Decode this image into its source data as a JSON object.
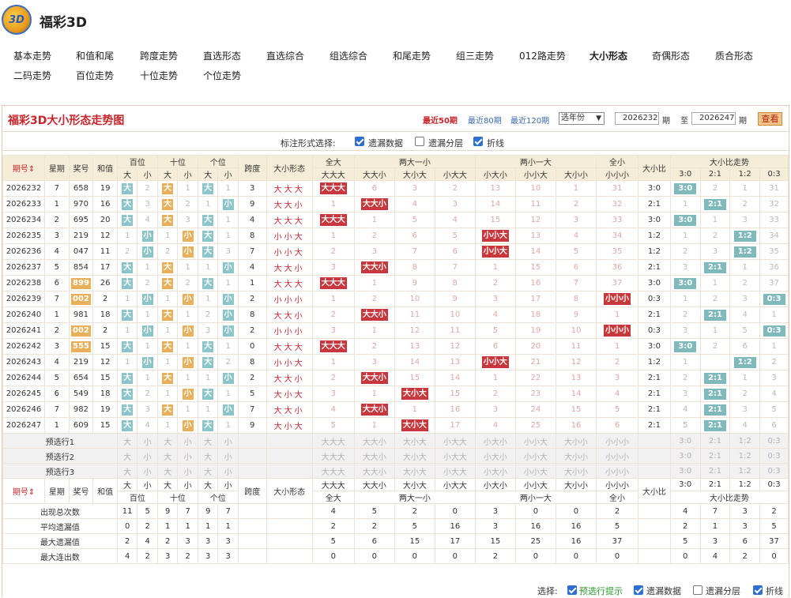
{
  "site": {
    "logo": "3D",
    "title": "福彩3D"
  },
  "nav": [
    "基本走势",
    "和值和尾",
    "跨度走势",
    "直选形态",
    "直选综合",
    "组选综合",
    "和尾走势",
    "组三走势",
    "012路走势",
    "大小形态",
    "奇偶形态",
    "质合形态",
    "二码走势",
    "百位走势",
    "十位走势",
    "个位走势"
  ],
  "nav_active": 9,
  "panel": {
    "title": "福彩3D大小形态走势图",
    "links": [
      "最近50期",
      "最近80期",
      "最近120期"
    ],
    "year_select": "选年份",
    "from": "2026232",
    "to": "2026247",
    "qi1": "期",
    "to_label": "至",
    "qi2": "期",
    "query": "查看"
  },
  "options": {
    "label": "标注形式选择:",
    "items": [
      {
        "label": "遗漏数据",
        "checked": true
      },
      {
        "label": "遗漏分层",
        "checked": false
      },
      {
        "label": "折线",
        "checked": true
      }
    ]
  },
  "headers": {
    "period": "期号",
    "week": "星期",
    "prize": "奖号",
    "sum": "和值",
    "bai": "百位",
    "shi": "十位",
    "ge": "个位",
    "big": "大",
    "small": "小",
    "span": "跨度",
    "shape": "大小形态",
    "g_all_big": "全大",
    "g_two_big": "两大一小",
    "g_two_small": "两小一大",
    "g_all_small": "全小",
    "ratio": "大小比",
    "trend": "大小比走势",
    "sub_all_big": "大大大",
    "sub_two_big": [
      "大大小",
      "大小大",
      "小大大"
    ],
    "sub_two_small": [
      "小大小",
      "小小大",
      "大小小"
    ],
    "sub_all_small": "小小小",
    "ratios": [
      "3:0",
      "2:1",
      "1:2",
      "0:3"
    ],
    "sort_icon": "⇕"
  },
  "rows": [
    {
      "p": "2026232",
      "w": "7",
      "n": "658",
      "nh": "",
      "s": "19",
      "d": [
        "大",
        "2",
        "大",
        "1",
        "大",
        "1"
      ],
      "sp": "3",
      "sh": "大大大",
      "a": [
        {
          "v": "大大大",
          "h": 1
        },
        "6",
        "3",
        "2",
        "13",
        "10",
        "1",
        "31"
      ],
      "r": "3:0",
      "t": [
        {
          "v": "3:0",
          "h": 1
        },
        "2",
        "1",
        "31"
      ]
    },
    {
      "p": "2026233",
      "w": "1",
      "n": "970",
      "nh": "",
      "s": "16",
      "d": [
        "大",
        "3",
        "大",
        "2",
        "1",
        "小"
      ],
      "sp": "9",
      "sh": "大大小",
      "a": [
        "1",
        {
          "v": "大大小",
          "h": 1
        },
        "4",
        "3",
        "14",
        "11",
        "2",
        "32"
      ],
      "r": "2:1",
      "t": [
        "1",
        {
          "v": "2:1",
          "h": 1
        },
        "2",
        "32"
      ]
    },
    {
      "p": "2026234",
      "w": "2",
      "n": "695",
      "nh": "",
      "s": "20",
      "d": [
        "大",
        "4",
        "大",
        "3",
        "大",
        "1"
      ],
      "sp": "4",
      "sh": "大大大",
      "a": [
        {
          "v": "大大大",
          "h": 1
        },
        "1",
        "5",
        "4",
        "15",
        "12",
        "3",
        "33"
      ],
      "r": "3:0",
      "t": [
        {
          "v": "3:0",
          "h": 1
        },
        "1",
        "3",
        "33"
      ]
    },
    {
      "p": "2026235",
      "w": "3",
      "n": "219",
      "nh": "",
      "s": "12",
      "d": [
        "1",
        "小",
        "1",
        "小",
        "大",
        "1"
      ],
      "sp": "8",
      "sh": "小小大",
      "a": [
        "1",
        "2",
        "6",
        "5",
        {
          "v": "小小大",
          "h": 1
        },
        "13",
        "4",
        "34"
      ],
      "r": "1:2",
      "t": [
        "1",
        "2",
        {
          "v": "1:2",
          "h": 1
        },
        "34"
      ]
    },
    {
      "p": "2026236",
      "w": "4",
      "n": "047",
      "nh": "",
      "s": "11",
      "d": [
        "2",
        "小",
        "2",
        "小",
        "大",
        "3"
      ],
      "sp": "7",
      "sh": "小小大",
      "a": [
        "2",
        "3",
        "7",
        "6",
        {
          "v": "小小大",
          "h": 1
        },
        "14",
        "5",
        "35"
      ],
      "r": "1:2",
      "t": [
        "2",
        "3",
        {
          "v": "1:2",
          "h": 1
        },
        "35"
      ]
    },
    {
      "p": "2026237",
      "w": "5",
      "n": "854",
      "nh": "",
      "s": "17",
      "d": [
        "大",
        "1",
        "大",
        "1",
        "1",
        "小"
      ],
      "sp": "4",
      "sh": "大大小",
      "a": [
        "3",
        {
          "v": "大大小",
          "h": 1
        },
        "8",
        "7",
        "1",
        "15",
        "6",
        "36"
      ],
      "r": "2:1",
      "t": [
        "3",
        {
          "v": "2:1",
          "h": 1
        },
        "1",
        "36"
      ]
    },
    {
      "p": "2026238",
      "w": "6",
      "n": "899",
      "nh": "o",
      "s": "26",
      "d": [
        "大",
        "2",
        "大",
        "2",
        "大",
        "1"
      ],
      "sp": "1",
      "sh": "大大大",
      "a": [
        {
          "v": "大大大",
          "h": 1
        },
        "1",
        "9",
        "8",
        "2",
        "16",
        "7",
        "37"
      ],
      "r": "3:0",
      "t": [
        {
          "v": "3:0",
          "h": 1
        },
        "1",
        "2",
        "37"
      ]
    },
    {
      "p": "2026239",
      "w": "7",
      "n": "002",
      "nh": "o",
      "s": "2",
      "d": [
        "1",
        "小",
        "1",
        "小",
        "1",
        "小"
      ],
      "sp": "2",
      "sh": "小小小",
      "a": [
        "1",
        "2",
        "10",
        "9",
        "3",
        "17",
        "8",
        {
          "v": "小小小",
          "h": 1
        }
      ],
      "r": "0:3",
      "t": [
        "1",
        "2",
        "3",
        {
          "v": "0:3",
          "h": 1
        }
      ]
    },
    {
      "p": "2026240",
      "w": "1",
      "n": "981",
      "nh": "",
      "s": "18",
      "d": [
        "大",
        "1",
        "大",
        "1",
        "2",
        "小"
      ],
      "sp": "8",
      "sh": "大大小",
      "a": [
        "2",
        {
          "v": "大大小",
          "h": 1
        },
        "11",
        "10",
        "4",
        "18",
        "9",
        "1"
      ],
      "r": "2:1",
      "t": [
        "2",
        {
          "v": "2:1",
          "h": 1
        },
        "4",
        "1"
      ]
    },
    {
      "p": "2026241",
      "w": "2",
      "n": "002",
      "nh": "o",
      "s": "2",
      "d": [
        "1",
        "小",
        "1",
        "小",
        "3",
        "小"
      ],
      "sp": "2",
      "sh": "小小小",
      "a": [
        "3",
        "1",
        "12",
        "11",
        "5",
        "19",
        "10",
        {
          "v": "小小小",
          "h": 1
        }
      ],
      "r": "0:3",
      "t": [
        "3",
        "1",
        "5",
        {
          "v": "0:3",
          "h": 1
        }
      ]
    },
    {
      "p": "2026242",
      "w": "3",
      "n": "555",
      "nh": "o",
      "s": "15",
      "d": [
        "大",
        "1",
        "大",
        "1",
        "大",
        "1"
      ],
      "sp": "0",
      "sh": "大大大",
      "a": [
        {
          "v": "大大大",
          "h": 1
        },
        "2",
        "13",
        "12",
        "6",
        "20",
        "11",
        "1"
      ],
      "r": "3:0",
      "t": [
        {
          "v": "3:0",
          "h": 1
        },
        "2",
        "6",
        "1"
      ]
    },
    {
      "p": "2026243",
      "w": "4",
      "n": "219",
      "nh": "",
      "s": "12",
      "d": [
        "1",
        "小",
        "1",
        "小",
        "大",
        "2"
      ],
      "sp": "8",
      "sh": "小小大",
      "a": [
        "1",
        "3",
        "14",
        "13",
        {
          "v": "小小大",
          "h": 1
        },
        "21",
        "12",
        "2"
      ],
      "r": "1:2",
      "t": [
        "1",
        {
          "v": "",
          "h": 0
        },
        {
          "v": "1:2",
          "h": 1
        },
        "2"
      ]
    },
    {
      "p": "2026244",
      "w": "5",
      "n": "654",
      "nh": "",
      "s": "15",
      "d": [
        "大",
        "1",
        "大",
        "1",
        "1",
        "小"
      ],
      "sp": "2",
      "sh": "大大小",
      "a": [
        "2",
        {
          "v": "大大小",
          "h": 1
        },
        "15",
        "14",
        "1",
        "22",
        "13",
        "3"
      ],
      "r": "2:1",
      "t": [
        "2",
        {
          "v": "2:1",
          "h": 1
        },
        "1",
        "3"
      ]
    },
    {
      "p": "2026245",
      "w": "6",
      "n": "549",
      "nh": "",
      "s": "18",
      "d": [
        "大",
        "2",
        "1",
        "小",
        "大",
        "1"
      ],
      "sp": "5",
      "sh": "大小大",
      "a": [
        "3",
        "1",
        {
          "v": "大小大",
          "h": 1
        },
        "15",
        "2",
        "23",
        "14",
        "4"
      ],
      "r": "2:1",
      "t": [
        "3",
        {
          "v": "2:1",
          "h": 1
        },
        "2",
        "4"
      ]
    },
    {
      "p": "2026246",
      "w": "7",
      "n": "982",
      "nh": "",
      "s": "19",
      "d": [
        "大",
        "3",
        "大",
        "1",
        "1",
        "小"
      ],
      "sp": "7",
      "sh": "大大小",
      "a": [
        "4",
        {
          "v": "大大小",
          "h": 1
        },
        "1",
        "16",
        "3",
        "24",
        "15",
        "5"
      ],
      "r": "2:1",
      "t": [
        "4",
        {
          "v": "2:1",
          "h": 1
        },
        "3",
        "5"
      ]
    },
    {
      "p": "2026247",
      "w": "1",
      "n": "609",
      "nh": "",
      "s": "15",
      "d": [
        "大",
        "4",
        "1",
        "小",
        "大",
        "1"
      ],
      "sp": "9",
      "sh": "大小大",
      "a": [
        "5",
        "1",
        {
          "v": "大小大",
          "h": 1
        },
        "17",
        "4",
        "25",
        "16",
        "6"
      ],
      "r": "2:1",
      "t": [
        "5",
        {
          "v": "2:1",
          "h": 1
        },
        "4",
        "6"
      ]
    }
  ],
  "pre_rows": [
    {
      "label": "预选行1",
      "d": [
        "大",
        "小",
        "大",
        "小",
        "大",
        "小"
      ],
      "a": [
        "大大大",
        "大大小",
        "大小大",
        "小大大",
        "小大小",
        "小小大",
        "大小小",
        "小小小"
      ],
      "t": [
        "3:0",
        "2:1",
        "1:2",
        "0:3"
      ]
    },
    {
      "label": "预选行2",
      "d": [
        "大",
        "小",
        "大",
        "小",
        "大",
        "小"
      ],
      "a": [
        "大大大",
        "大大小",
        "大小大",
        "小大大",
        "小大小",
        "小小大",
        "大小小",
        "小小小"
      ],
      "t": [
        "3:0",
        "2:1",
        "1:2",
        "0:3"
      ]
    },
    {
      "label": "预选行3",
      "d": [
        "大",
        "小",
        "大",
        "小",
        "大",
        "小"
      ],
      "a": [
        "大大大",
        "大大小",
        "大小大",
        "小大大",
        "小大小",
        "小小大",
        "大小小",
        "小小小"
      ],
      "t": [
        "3:0",
        "2:1",
        "1:2",
        "0:3"
      ]
    }
  ],
  "stats": [
    {
      "label": "出现总次数",
      "d": [
        "11",
        "5",
        "9",
        "7",
        "9",
        "7"
      ],
      "a": [
        "4",
        "5",
        "2",
        "0",
        "3",
        "0",
        "0",
        "2"
      ],
      "t": [
        "4",
        "7",
        "3",
        "2"
      ]
    },
    {
      "label": "平均遗漏值",
      "d": [
        "0",
        "2",
        "1",
        "1",
        "1",
        "1"
      ],
      "a": [
        "2",
        "2",
        "5",
        "16",
        "3",
        "16",
        "16",
        "5"
      ],
      "t": [
        "2",
        "1",
        "3",
        "5"
      ]
    },
    {
      "label": "最大遗漏值",
      "d": [
        "2",
        "4",
        "2",
        "3",
        "3",
        "3"
      ],
      "a": [
        "5",
        "6",
        "15",
        "17",
        "15",
        "25",
        "16",
        "37"
      ],
      "t": [
        "5",
        "3",
        "6",
        "37"
      ]
    },
    {
      "label": "最大连出数",
      "d": [
        "4",
        "2",
        "3",
        "2",
        "3",
        "3"
      ],
      "a": [
        "0",
        "0",
        "0",
        "0",
        "2",
        "0",
        "0",
        "0"
      ],
      "t": [
        "0",
        "4",
        "2",
        "0"
      ]
    }
  ],
  "footer": {
    "label": "选择:",
    "items": [
      {
        "label": "预选行提示",
        "checked": true,
        "accent": "#2a9a2a"
      },
      {
        "label": "遗漏数据",
        "checked": true
      },
      {
        "label": "遗漏分层",
        "checked": false
      },
      {
        "label": "折线",
        "checked": true
      }
    ]
  }
}
